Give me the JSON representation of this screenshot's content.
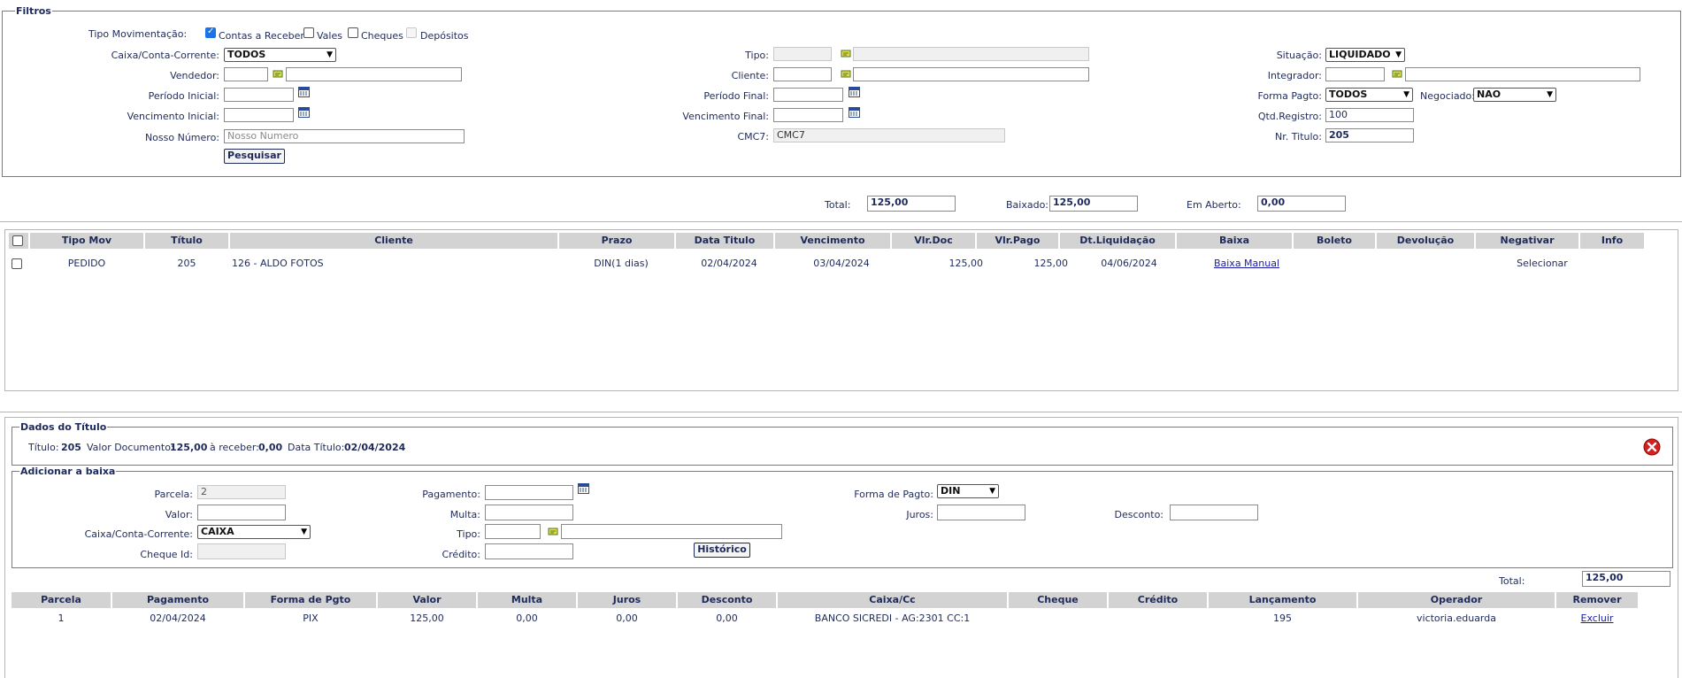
{
  "filtros": {
    "legend": "Filtros",
    "tipo_mov_label": "Tipo Movimentação:",
    "checks": [
      {
        "label": "Contas a Receber",
        "checked": true
      },
      {
        "label": "Vales",
        "checked": false
      },
      {
        "label": "Cheques",
        "checked": false
      },
      {
        "label": "Depósitos",
        "checked": false,
        "disabled": true
      }
    ],
    "caixa_label": "Caixa/Conta-Corrente:",
    "caixa_value": "TODOS",
    "vendedor_label": "Vendedor:",
    "periodo_inicial_label": "Período Inicial:",
    "vencimento_inicial_label": "Vencimento Inicial:",
    "nosso_numero_label": "Nosso Número:",
    "nosso_numero_placeholder": "Nosso Numero",
    "pesquisar": "Pesquisar",
    "tipo_label": "Tipo:",
    "cliente_label": "Cliente:",
    "periodo_final_label": "Período Final:",
    "vencimento_final_label": "Vencimento Final:",
    "cmc7_label": "CMC7:",
    "cmc7_value": "CMC7",
    "situacao_label": "Situação:",
    "situacao_value": "LIQUIDADO",
    "integrador_label": "Integrador:",
    "forma_pagto_label": "Forma Pagto:",
    "forma_pagto_value": "TODOS",
    "negociado_label": "Negociado:",
    "negociado_value": "NAO",
    "qtd_registro_label": "Qtd.Registro:",
    "qtd_registro_value": "100",
    "nr_titulo_label": "Nr. Titulo:",
    "nr_titulo_value": "205"
  },
  "totals": {
    "total_label": "Total:",
    "total_value": "125,00",
    "baixado_label": "Baixado:",
    "baixado_value": "125,00",
    "aberto_label": "Em Aberto:",
    "aberto_value": "0,00"
  },
  "main_table": {
    "headers": [
      "Tipo Mov",
      "Título",
      "Cliente",
      "Prazo",
      "Data Titulo",
      "Vencimento",
      "Vlr.Doc",
      "Vlr.Pago",
      "Dt.Liquidação",
      "Baixa",
      "Boleto",
      "Devolução",
      "Negativar",
      "Info"
    ],
    "row": {
      "tipo_mov": "PEDIDO",
      "titulo": "205",
      "cliente": "126 - ALDO FOTOS",
      "prazo": "DIN(1 dias)",
      "data_titulo": "02/04/2024",
      "vencimento": "03/04/2024",
      "vlr_doc": "125,00",
      "vlr_pago": "125,00",
      "dt_liquidacao": "04/06/2024",
      "baixa": "Baixa Manual",
      "negativar": "Selecionar"
    }
  },
  "dados_titulo": {
    "legend": "Dados do Título",
    "titulo_label": "Título:",
    "titulo_value": "205",
    "valor_doc_label": "Valor Documento:",
    "valor_doc_value": "125,00",
    "receber_label": "à receber:",
    "receber_value": "0,00",
    "data_titulo_label": "Data Título:",
    "data_titulo_value": "02/04/2024"
  },
  "baixa": {
    "legend": "Adicionar a baixa",
    "parcela_label": "Parcela:",
    "parcela_value": "2",
    "valor_label": "Valor:",
    "caixa_label": "Caixa/Conta-Corrente:",
    "caixa_value": "CAIXA",
    "cheque_id_label": "Cheque Id:",
    "pagamento_label": "Pagamento:",
    "multa_label": "Multa:",
    "tipo_label": "Tipo:",
    "credito_label": "Crédito:",
    "historico": "Histórico",
    "forma_pagto_label": "Forma de Pagto:",
    "forma_pagto_value": "DIN",
    "juros_label": "Juros:",
    "desconto_label": "Desconto:",
    "total_label": "Total:",
    "total_value": "125,00"
  },
  "baixa_table": {
    "headers": [
      "Parcela",
      "Pagamento",
      "Forma de Pgto",
      "Valor",
      "Multa",
      "Juros",
      "Desconto",
      "Caixa/Cc",
      "Cheque",
      "Crédito",
      "Lançamento",
      "Operador",
      "Remover"
    ],
    "row": {
      "parcela": "1",
      "pagamento": "02/04/2024",
      "forma": "PIX",
      "valor": "125,00",
      "multa": "0,00",
      "juros": "0,00",
      "desconto": "0,00",
      "caixa": "BANCO SICREDI - AG:2301 CC:1",
      "lancamento": "195",
      "operador": "victoria.eduarda",
      "remover": "Excluir"
    }
  }
}
